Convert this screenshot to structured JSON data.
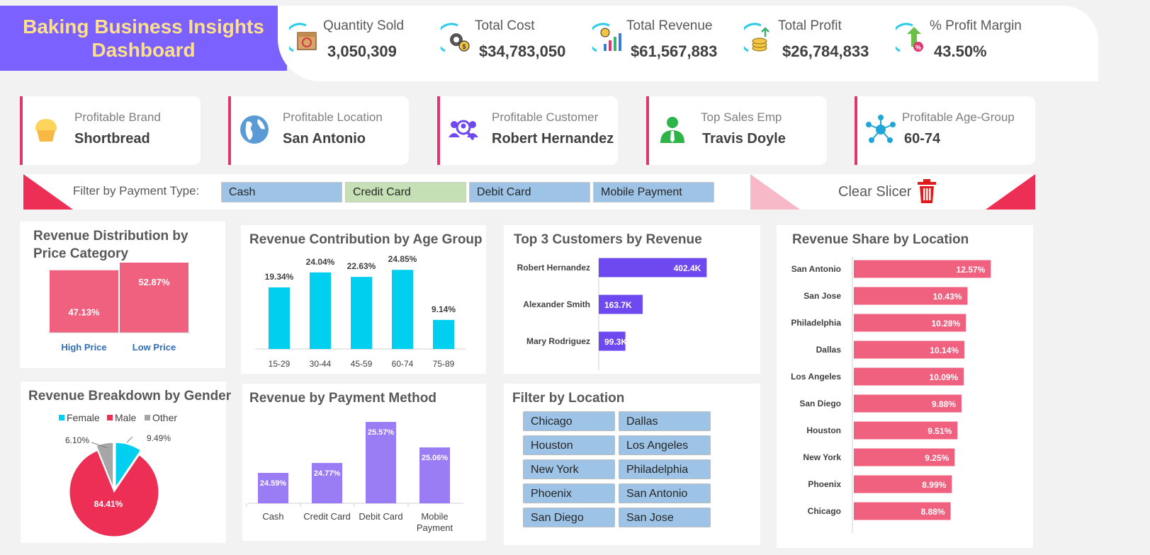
{
  "header": {
    "title": "Baking Business Insights Dashboard"
  },
  "kpis": [
    {
      "label": "Quantity Sold",
      "value": "3,050,309",
      "icon": "box-icon"
    },
    {
      "label": "Total Cost",
      "value": "$34,783,050",
      "icon": "gear-dollar-icon"
    },
    {
      "label": "Total Revenue",
      "value": "$61,567,883",
      "icon": "revenue-chart-icon"
    },
    {
      "label": "Total Profit",
      "value": "$26,784,833",
      "icon": "coins-icon"
    },
    {
      "label": "% Profit Margin",
      "value": "43.50%",
      "icon": "percent-arrow-icon"
    }
  ],
  "insights": [
    {
      "label": "Profitable Brand",
      "value": "Shortbread",
      "icon": "cupcake-icon"
    },
    {
      "label": "Profitable Location",
      "value": "San Antonio",
      "icon": "globe-icon"
    },
    {
      "label": "Profitable Customer",
      "value": "Robert Hernandez",
      "icon": "customer-search-icon"
    },
    {
      "label": "Top Sales Emp",
      "value": "Travis Doyle",
      "icon": "employee-icon"
    },
    {
      "label": "Profitable Age-Group",
      "value": "60-74",
      "icon": "network-icon"
    }
  ],
  "payment_slicer": {
    "label": "Filter by Payment Type:",
    "options": [
      "Cash",
      "Credit Card",
      "Debit Card",
      "Mobile Payment"
    ],
    "clear_label": "Clear Slicer"
  },
  "location_slicer": {
    "title": "Filter by Location",
    "options": [
      "Chicago",
      "Dallas",
      "Houston",
      "Los Angeles",
      "New York",
      "Philadelphia",
      "Phoenix",
      "San Antonio",
      "San Diego",
      "San Jose"
    ]
  },
  "colors": {
    "purple": "#7b61ff",
    "pink": "#f0607f",
    "cyan": "#00cfef",
    "red": "#ee2f55",
    "bar_purple": "#6e49f0",
    "lavender": "#9a7cf5",
    "gray": "#a6a6a6"
  },
  "chart_data": [
    {
      "id": "price",
      "type": "bar",
      "title": "Revenue Distribution by Price Category",
      "categories": [
        "High Price",
        "Low Price"
      ],
      "values": [
        47.13,
        52.87
      ],
      "labels": [
        "47.13%",
        "52.87%"
      ]
    },
    {
      "id": "age",
      "type": "bar",
      "title": "Revenue Contribution by Age Group",
      "categories": [
        "15-29",
        "30-44",
        "45-59",
        "60-74",
        "75-89"
      ],
      "values": [
        19.34,
        24.04,
        22.63,
        24.85,
        9.14
      ],
      "labels": [
        "19.34%",
        "24.04%",
        "22.63%",
        "24.85%",
        "9.14%"
      ]
    },
    {
      "id": "top3",
      "type": "bar",
      "title": "Top 3 Customers by Revenue",
      "categories": [
        "Robert Hernandez",
        "Alexander Smith",
        "Mary Rodriguez"
      ],
      "values": [
        402.4,
        163.7,
        99.3
      ],
      "labels": [
        "402.4K",
        "163.7K",
        "99.3K"
      ]
    },
    {
      "id": "location",
      "type": "bar",
      "title": "Revenue Share by Location",
      "categories": [
        "San Antonio",
        "San Jose",
        "Philadelphia",
        "Dallas",
        "Los Angeles",
        "San Diego",
        "Houston",
        "New York",
        "Phoenix",
        "Chicago"
      ],
      "values": [
        12.57,
        10.43,
        10.28,
        10.14,
        10.09,
        9.88,
        9.51,
        9.25,
        8.99,
        8.88
      ],
      "labels": [
        "12.57%",
        "10.43%",
        "10.28%",
        "10.14%",
        "10.09%",
        "9.88%",
        "9.51%",
        "9.25%",
        "8.99%",
        "8.88%"
      ]
    },
    {
      "id": "gender",
      "type": "pie",
      "title": "Revenue Breakdown by Gender",
      "categories": [
        "Female",
        "Male",
        "Other"
      ],
      "values": [
        9.49,
        84.41,
        6.1
      ],
      "labels": [
        "9.49%",
        "84.41%",
        "6.10%"
      ],
      "legend": "top"
    },
    {
      "id": "payment",
      "type": "bar",
      "title": "Revenue by Payment Method",
      "categories": [
        "Cash",
        "Credit Card",
        "Debit Card",
        "Mobile Payment"
      ],
      "values": [
        24.59,
        24.77,
        25.57,
        25.06
      ],
      "labels": [
        "24.59%",
        "24.77%",
        "25.57%",
        "25.06%"
      ]
    }
  ]
}
